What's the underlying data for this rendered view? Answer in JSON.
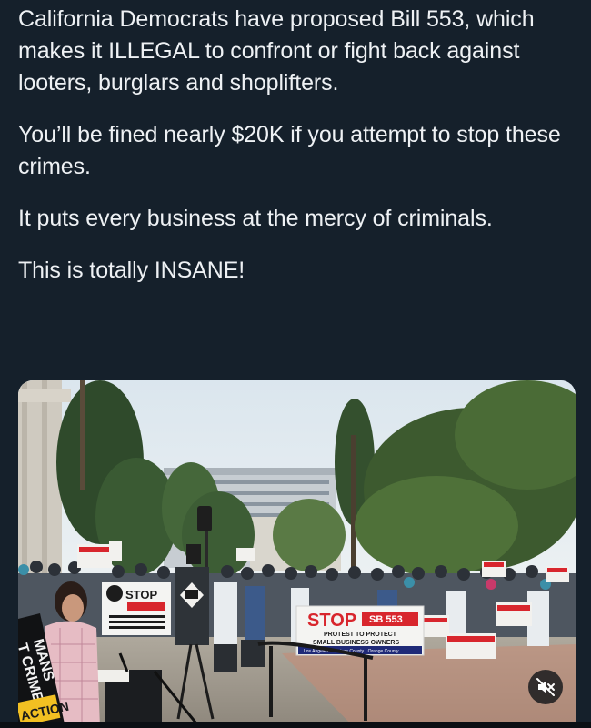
{
  "post": {
    "paragraphs": [
      "California Democrats have proposed Bill 553, which makes it ILLEGAL to confront or fight back against looters, burglars and shoplifters.",
      "You’ll be fined nearly $20K if you attempt to stop these crimes.",
      "It puts every business at the mercy of criminals.",
      "This is totally INSANE!"
    ]
  },
  "media": {
    "signs": {
      "stop_word": "STOP",
      "bill_tag": "SB 553",
      "line1": "PROTEST TO PROTECT",
      "line2": "SMALL BUSINESS OWNERS",
      "line3": "Los Angeles · Ventura County · Orange County",
      "left_banner_1": "MANS",
      "left_banner_2": "T CRIME",
      "left_banner_3": "ACTION"
    },
    "controls": {
      "mute_icon": "speaker-muted-icon"
    }
  },
  "colors": {
    "background": "#15202b",
    "text": "#eef1f4",
    "sign_red": "#d8262d",
    "sign_white": "#f4f4f2"
  }
}
